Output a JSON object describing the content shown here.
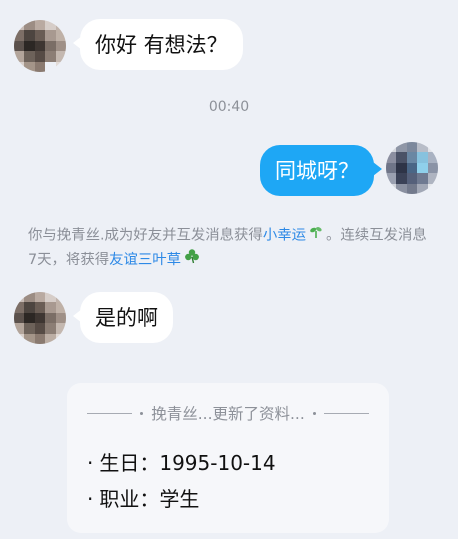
{
  "messages": [
    {
      "side": "left",
      "text": "你好 有想法？"
    },
    {
      "side": "right",
      "text": "同城呀？"
    },
    {
      "side": "left",
      "text": "是的啊"
    }
  ],
  "timestamp": "00:40",
  "system_notice": {
    "part1": "你与挽青丝.成为好友并互发消息获得",
    "link1": "小幸运",
    "icon1": "sprout-icon",
    "part2": "。连续互发消息7天，将获得",
    "link2": "友谊三叶草",
    "icon2": "clover-icon"
  },
  "profile_card": {
    "title": "挽青丝...更新了资料...",
    "birthday_label": "生日：",
    "birthday_value": "1995-10-14",
    "job_label": "职业：",
    "job_value": "学生",
    "bullet": "·"
  },
  "colors": {
    "background": "#edf0f6",
    "my_bubble": "#1ea7f5",
    "link": "#2d89e6",
    "muted_text": "#8b8f98"
  }
}
